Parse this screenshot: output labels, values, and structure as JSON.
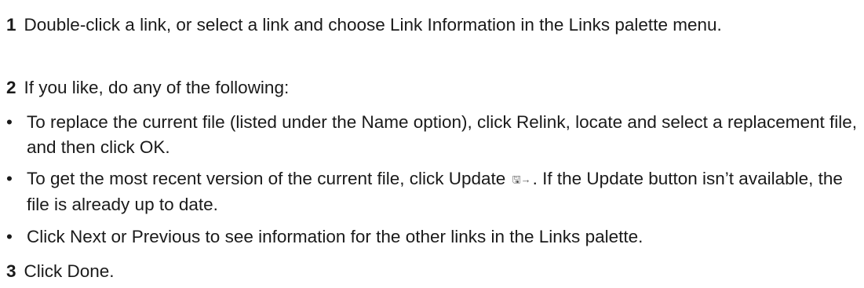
{
  "steps": [
    {
      "number": "1",
      "text": "Double-click a link, or select a link and choose Link Information in the Links palette menu."
    },
    {
      "number": "2",
      "text": "If you like, do any of the following:"
    },
    {
      "number": "3",
      "text": "Click Done."
    }
  ],
  "bullets": [
    {
      "text": "To replace the current file (listed under the Name option), click Relink, locate and select a replacement file, and then click OK."
    },
    {
      "text_before": "To get the most recent version of the current file, click Update",
      "icon": "update-link-icon",
      "text_after": ". If the Update button isn’t available, the file is already up to date."
    },
    {
      "text": "Click Next or Previous to see information for the other links in the Links palette."
    }
  ],
  "bullet_symbol": "•",
  "update_icon_glyph": "🖫→"
}
